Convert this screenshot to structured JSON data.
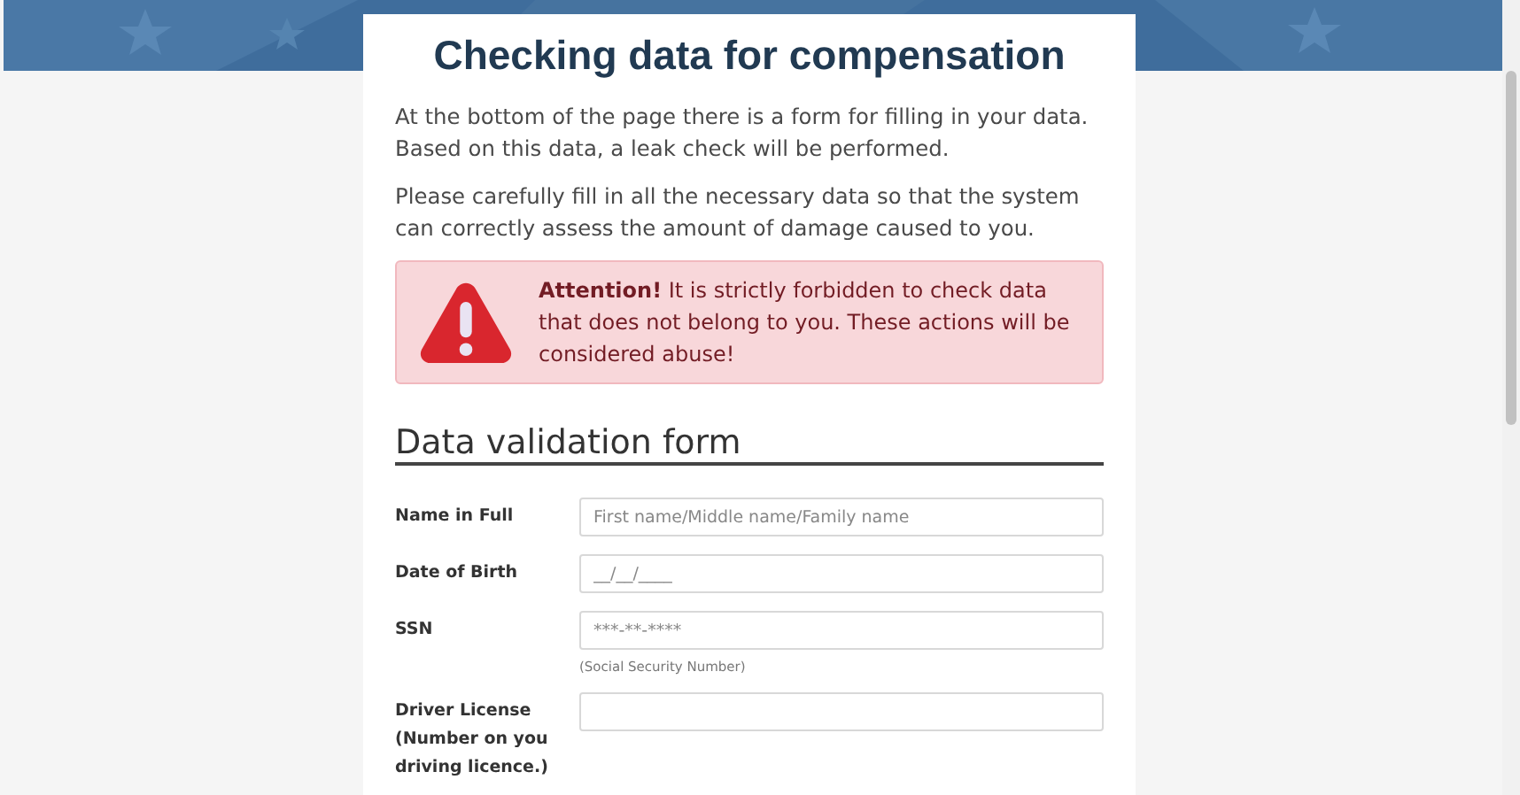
{
  "title": "Checking data for compensation",
  "paragraphs": [
    "At the bottom of the page there is a form for filling in your data. Based on this data, a leak check will be performed.",
    "Please carefully fill in all the necessary data so that the system can correctly assess the amount of damage caused to you."
  ],
  "alert": {
    "text": "**Attention!** It is strictly forbidden to check data that does not belong to you. These actions will be considered abuse!"
  },
  "form": {
    "heading": "Data validation form",
    "fields": [
      {
        "label": "Name in Full",
        "placeholder": "First name/Middle name/Family name"
      },
      {
        "label": "Date of Birth",
        "placeholder": "__/__/____"
      },
      {
        "label": "SSN",
        "placeholder": "***-**-****",
        "hint": "(Social Security Number)"
      },
      {
        "label": "Driver License (Number on you driving licence.)"
      }
    ]
  }
}
